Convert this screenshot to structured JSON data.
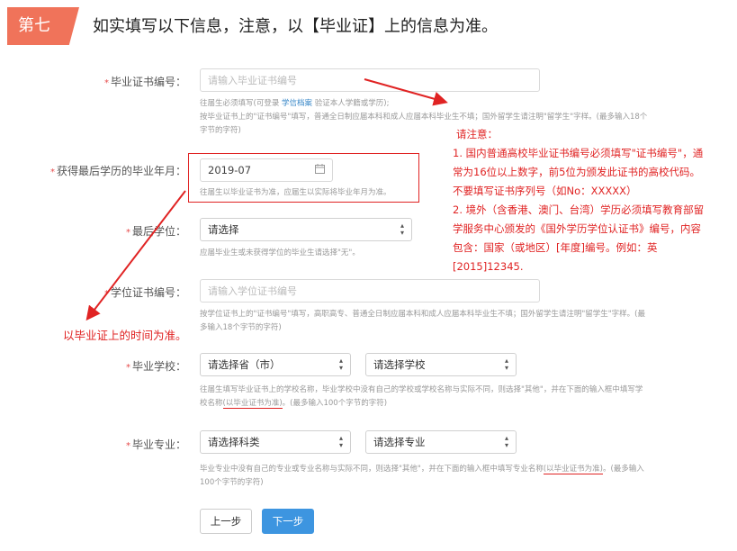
{
  "header": {
    "step": "第七",
    "title": "如实填写以下信息，注意，以【毕业证】上的信息为准。"
  },
  "form": {
    "cert_no": {
      "label": "毕业证书编号：",
      "placeholder": "请输入毕业证书编号",
      "help1_a": "往届生必须填写(可登录",
      "help1_link": "学信档案",
      "help1_b": "验证本人学籍或学历);",
      "help2": "按毕业证书上的\"证书编号\"填写，普通全日制应届本科和成人应届本科毕业生不填；国外留学生请注明\"留学生\"字样。(最多输入18个",
      "help3": "字节的字符)"
    },
    "grad_date": {
      "label": "获得最后学历的毕业年月：",
      "value": "2019-07",
      "help": "往届生以毕业证书为准，应届生以实际将毕业年月为准。"
    },
    "degree": {
      "label": "最后学位：",
      "selected": "请选择",
      "help": "应届毕业生或未获得学位的毕业生请选择\"无\"。"
    },
    "degree_cert": {
      "label": "学位证书编号：",
      "placeholder": "请输入学位证书编号",
      "help1": "按学位证书上的\"证书编号\"填写，高职高专、普通全日制应届本科和成人应届本科毕业生不填；国外留学生请注明\"留学生\"字样。(最",
      "help2": "多输入18个字节的字符)"
    },
    "school": {
      "label": "毕业学校：",
      "province": "请选择省（市）",
      "school": "请选择学校",
      "help1": "往届生填写毕业证书上的学校名称，毕业学校中没有自己的学校或学校名称与实际不同，则选择\"其他\"，并在下面的输入框中填写学",
      "help2_a": "校名称",
      "help2_u": "(以毕业证书为准)",
      "help2_b": "。(最多输入100个字节的字符)"
    },
    "major": {
      "label": "毕业专业：",
      "category": "请选择科类",
      "major": "请选择专业",
      "help1_a": "毕业专业中没有自己的专业或专业名称与实际不同，则选择\"其他\"，并在下面的输入框中填写专业名称",
      "help1_u": "(以毕业证书为准)",
      "help1_b": "。(最多输入",
      "help2": "100个字节的字符)"
    },
    "buttons": {
      "prev": "上一步",
      "next": "下一步"
    }
  },
  "annotations": {
    "note_title": "请注意：",
    "note_lines": [
      "1. 国内普通高校毕业证书编号必须填写\"证书编号\"，通",
      "常为16位以上数字，前5位为颁发此证书的高校代码。",
      "不要填写证书序列号（如No：XXXXX）",
      "2. 境外（含香港、澳门、台湾）学历必须填写教育部留",
      "学服务中心颁发的《国外学历学位认证书》编号，内容",
      "包含：国家（或地区）[年度]编号。例如：英",
      "[2015]12345."
    ],
    "left_note": "以毕业证上的时间为准。"
  },
  "colors": {
    "badge": "#f0735a",
    "annotation_red": "#e02323",
    "next_button": "#3d95e0",
    "link": "#3a88c8"
  },
  "icons": {
    "calendar": "calendar-icon",
    "select_arrow": "updown-arrow-icon"
  }
}
